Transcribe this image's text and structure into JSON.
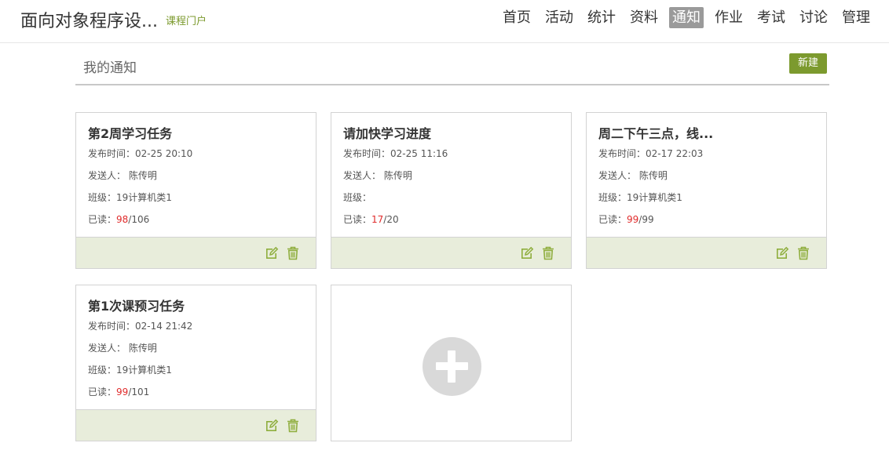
{
  "header": {
    "course_title": "面向对象程序设...",
    "portal_label": "课程门户",
    "nav": [
      {
        "label": "首页",
        "active": false
      },
      {
        "label": "活动",
        "active": false
      },
      {
        "label": "统计",
        "active": false
      },
      {
        "label": "资料",
        "active": false
      },
      {
        "label": "通知",
        "active": true
      },
      {
        "label": "作业",
        "active": false
      },
      {
        "label": "考试",
        "active": false
      },
      {
        "label": "讨论",
        "active": false
      },
      {
        "label": "管理",
        "active": false
      }
    ]
  },
  "page": {
    "title": "我的通知",
    "new_label": "新建"
  },
  "labels": {
    "publish_time": "发布时间：",
    "sender": "发送人：",
    "class": "班级：",
    "read": "已读："
  },
  "notices": [
    {
      "title": "第2周学习任务",
      "publish_time": "02-25 20:10",
      "sender": "陈传明",
      "class": "19计算机类1",
      "read": "98",
      "total": "/106"
    },
    {
      "title": "请加快学习进度",
      "publish_time": "02-25 11:16",
      "sender": "陈传明",
      "class": "",
      "read": "17",
      "total": "/20"
    },
    {
      "title": "周二下午三点，线...",
      "publish_time": "02-17 22:03",
      "sender": "陈传明",
      "class": "19计算机类1",
      "read": "99",
      "total": "/99"
    },
    {
      "title": "第1次课预习任务",
      "publish_time": "02-14 21:42",
      "sender": "陈传明",
      "class": "19计算机类1",
      "read": "99",
      "total": "/101"
    }
  ],
  "colors": {
    "accent": "#7c9a2e",
    "card_footer": "#e8eddb",
    "read_count": "#e02b2b",
    "nav_active_bg": "#9a9a9a"
  },
  "icons": {
    "edit": "edit-icon",
    "delete": "trash-icon",
    "add": "plus-icon"
  }
}
